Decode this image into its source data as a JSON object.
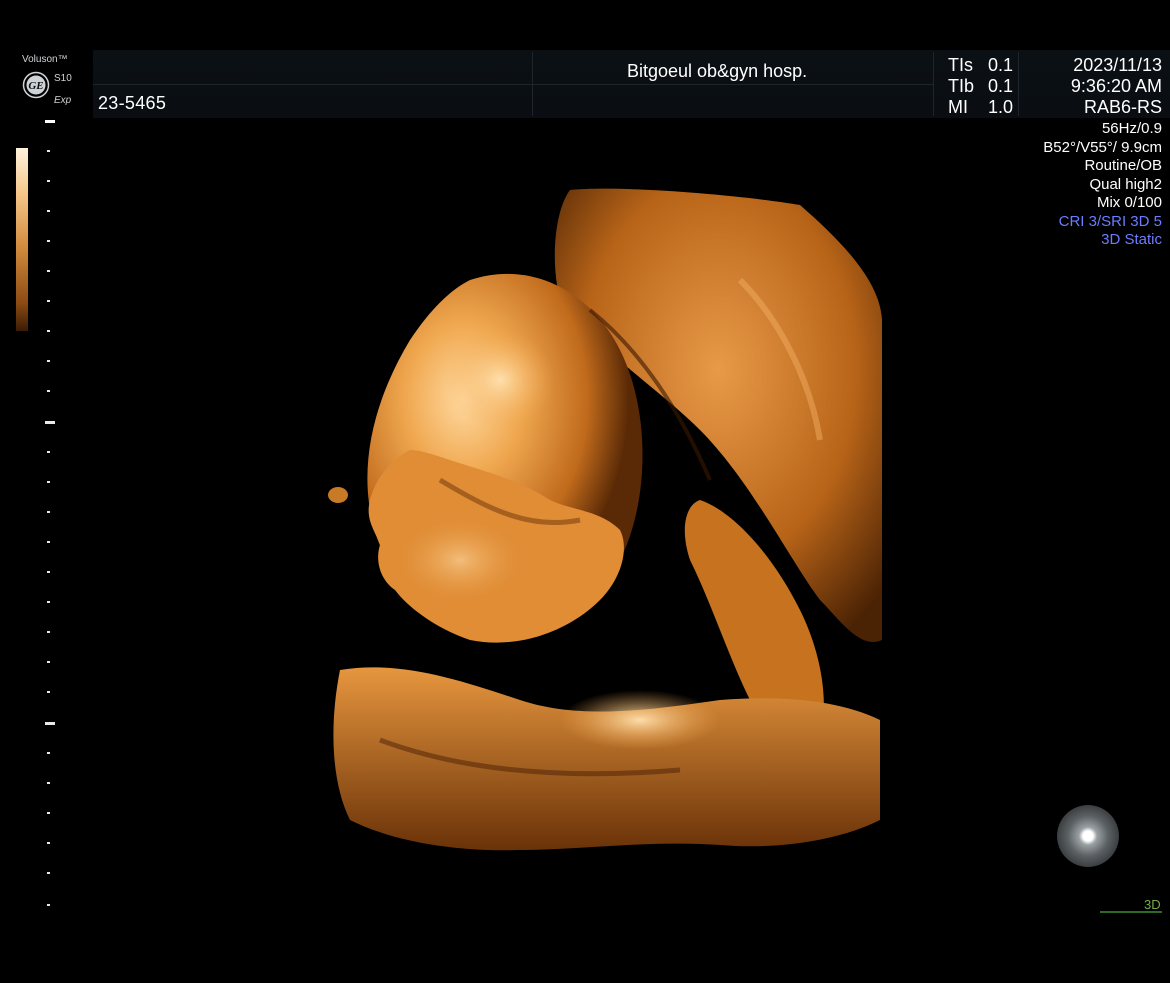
{
  "header": {
    "brand": "Voluson™",
    "model": "S10",
    "mode_tag": "Exp",
    "patient_id": "23-5465",
    "hospital": "Bitgoeul ob&gyn hosp."
  },
  "acoustic": {
    "tis_label": "TIs",
    "tis_value": "0.1",
    "tib_label": "TIb",
    "tib_value": "0.1",
    "mi_label": "MI",
    "mi_value": "1.0"
  },
  "session": {
    "date": "2023/11/13",
    "time": "9:36:20 AM",
    "probe": "RAB6-RS"
  },
  "params": {
    "frame_rate": "56Hz/0.9",
    "angles": "B52°/V55°/ 9.9cm",
    "preset": "Routine/OB",
    "quality": "Qual high2",
    "mix": "Mix 0/100",
    "cri": "CRI 3/SRI 3D 5",
    "render_mode": "3D Static"
  },
  "status": {
    "mode_label": "3D"
  },
  "colors": {
    "accent_blue": "#6c7cff",
    "mode_green": "#6fae4a",
    "render_orange": "#d8862a"
  },
  "icons": {
    "ge_logo": "ge-logo-icon",
    "orientation": "orientation-sphere-icon"
  }
}
